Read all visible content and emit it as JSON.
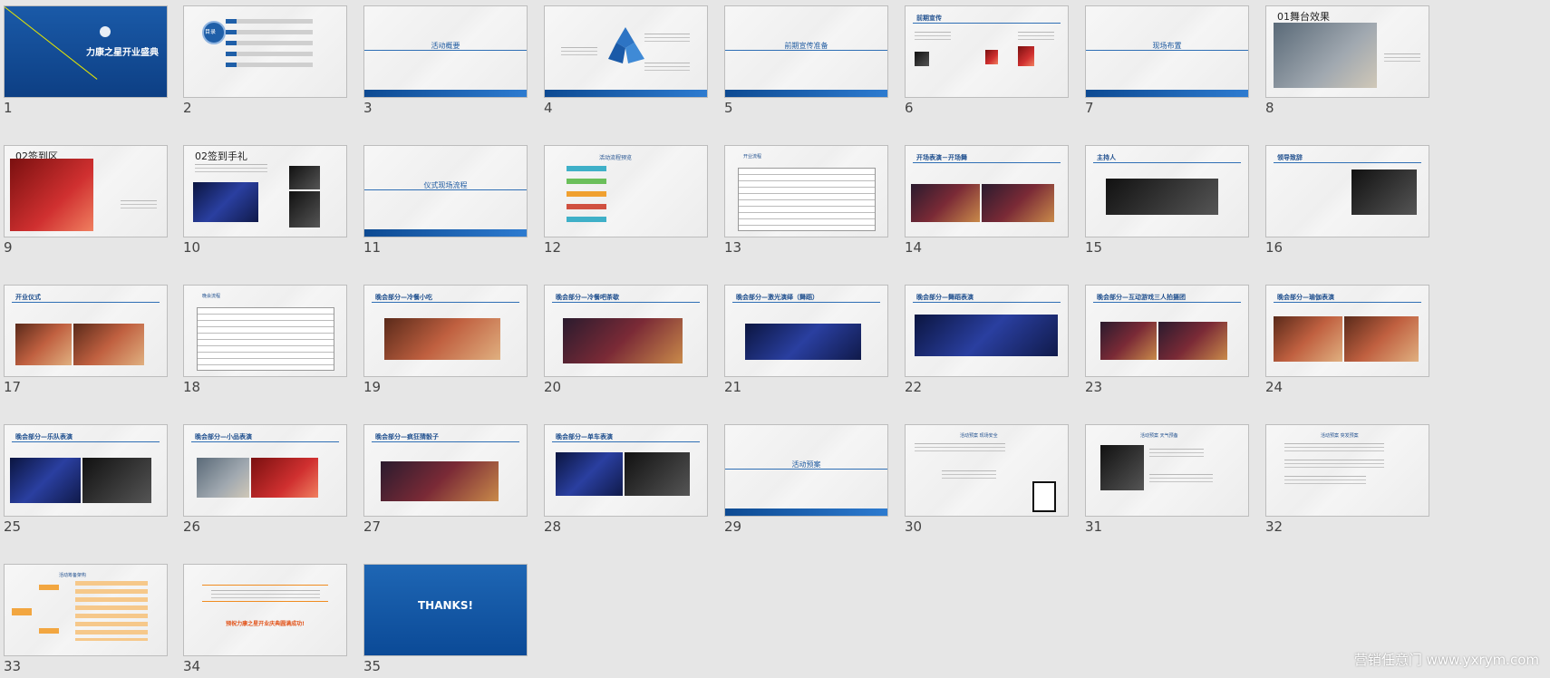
{
  "window": {
    "title": ""
  },
  "slides": [
    {
      "n": "1",
      "cover_title": "力康之星开业盛典"
    },
    {
      "n": "2",
      "toc_label": "目录"
    },
    {
      "n": "3",
      "section_title": "活动概要"
    },
    {
      "n": "4"
    },
    {
      "n": "5",
      "section_title": "前期宣传准备"
    },
    {
      "n": "6",
      "heading": "前期宣传"
    },
    {
      "n": "7",
      "section_title": "现场布置"
    },
    {
      "n": "8",
      "heading": "01舞台效果"
    },
    {
      "n": "9",
      "heading": "02签到区"
    },
    {
      "n": "10",
      "heading": "02签到手礼"
    },
    {
      "n": "11",
      "section_title": "仪式现场流程"
    },
    {
      "n": "12",
      "heading": "活动流程预览"
    },
    {
      "n": "13",
      "heading": "开业流程"
    },
    {
      "n": "14",
      "heading": "开场表演－开场舞"
    },
    {
      "n": "15",
      "heading": "主持人"
    },
    {
      "n": "16",
      "heading": "领导致辞"
    },
    {
      "n": "17",
      "heading": "开业仪式"
    },
    {
      "n": "18",
      "heading": "晚会流程"
    },
    {
      "n": "19",
      "heading": "晚会部分—冷餐小吃"
    },
    {
      "n": "20",
      "heading": "晚会部分—冷餐吧茶歇"
    },
    {
      "n": "21",
      "heading": "晚会部分—激光演绎（舞蹈）"
    },
    {
      "n": "22",
      "heading": "晚会部分—舞蹈表演"
    },
    {
      "n": "23",
      "heading": "晚会部分—互动游戏三人拍摄团"
    },
    {
      "n": "24",
      "heading": "晚会部分—瑜伽表演"
    },
    {
      "n": "25",
      "heading": "晚会部分—乐队表演"
    },
    {
      "n": "26",
      "heading": "晚会部分—小品表演"
    },
    {
      "n": "27",
      "heading": "晚会部分—疯狂猜骰子"
    },
    {
      "n": "28",
      "heading": "晚会部分—单车表演"
    },
    {
      "n": "29",
      "section_title": "活动预案"
    },
    {
      "n": "30",
      "heading": "活动预案 现场安全"
    },
    {
      "n": "31",
      "heading": "活动预案 天气预备"
    },
    {
      "n": "32",
      "heading": "活动预案 突发预案"
    },
    {
      "n": "33",
      "heading": "活动筹备架构"
    },
    {
      "n": "34",
      "heading": "预祝力康之星开业庆典圆满成功!"
    },
    {
      "n": "35",
      "thanks": "THANKS!"
    }
  ],
  "watermark": "营销任意门 www.yxrym.com"
}
